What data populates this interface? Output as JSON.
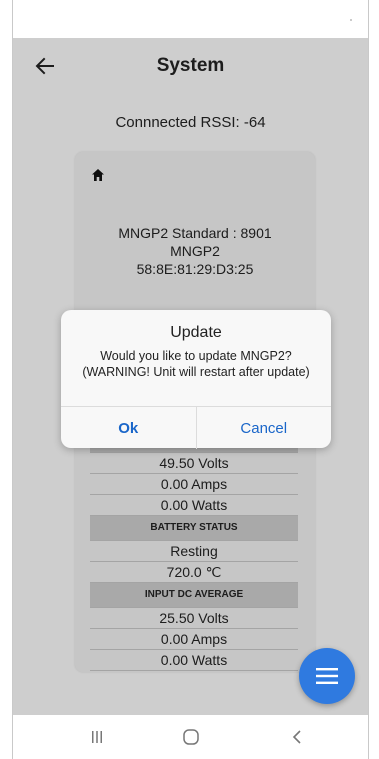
{
  "app": {
    "title": "System",
    "rssi_text": "Connnected RSSI: -64"
  },
  "device": {
    "model_line": "MNGP2 Standard : 8901",
    "name": "MNGP2",
    "mac": "58:8E:81:29:D3:25"
  },
  "readings": {
    "output": [
      "49.50 Volts",
      "0.00 Amps",
      "0.00 Watts"
    ],
    "battery_header": "BATTERY STATUS",
    "battery": [
      "Resting",
      "720.0 ℃"
    ],
    "input_header": "INPUT DC AVERAGE",
    "input": [
      "25.50 Volts",
      "0.00 Amps",
      "0.00 Watts"
    ]
  },
  "dialog": {
    "title": "Update",
    "message": "Would you like to update MNGP2? (WARNING! Unit will restart after update)",
    "ok_label": "Ok",
    "cancel_label": "Cancel"
  },
  "icons": {
    "back": "arrow-left-icon",
    "home": "home-icon",
    "fab": "menu-icon",
    "nav_recents": "recents-icon",
    "nav_home": "home-circle-icon",
    "nav_back": "chevron-left-icon"
  },
  "colors": {
    "accent": "#2f7ae0",
    "dialog_button": "#1a66c9",
    "screen_bg": "#ededed"
  }
}
